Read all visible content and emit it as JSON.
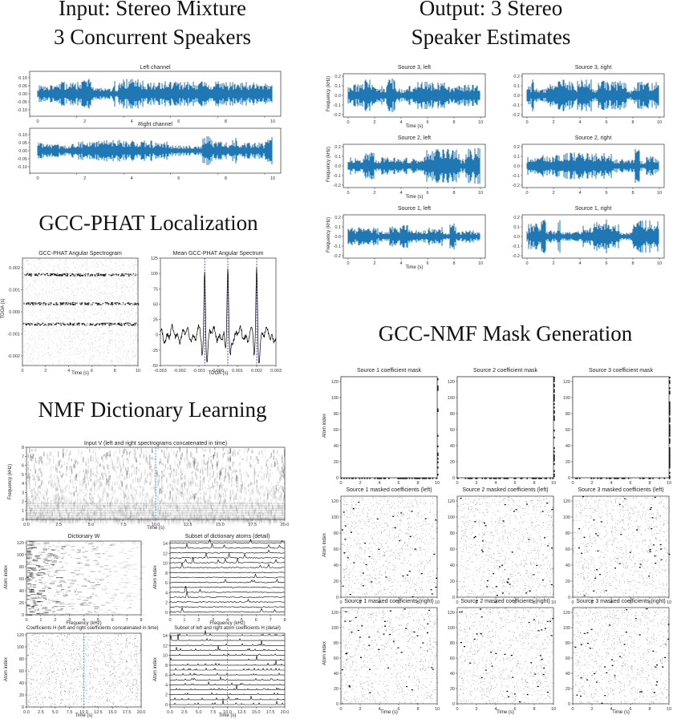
{
  "headings": {
    "input": [
      "Input: Stereo Mixture",
      "3 Concurrent Speakers"
    ],
    "output": [
      "Output: 3 Stereo",
      "Speaker Estimates"
    ],
    "gcc_phat": "GCC-PHAT Localization",
    "nmf": "NMF Dictionary Learning",
    "mask": "GCC-NMF Mask Generation"
  },
  "input_panels": {
    "left_title": "Left channel",
    "right_title": "Right channel",
    "yticks": [
      "0.10",
      "0.05",
      "0.00",
      "-0.05",
      "-0.10"
    ],
    "xticks": [
      "0",
      "2",
      "4",
      "6",
      "8",
      "10"
    ]
  },
  "output_panels": {
    "titles": [
      "Source 3, left",
      "Source 3, right",
      "Source 2, left",
      "Source 2, right",
      "Source 1, left",
      "Source 1, right"
    ],
    "ylabel": "Frequency (kHz)",
    "xlabel": "Time (s)",
    "yticks": [
      "0.2",
      "0.1",
      "0.0",
      "-0.1",
      "-0.2"
    ],
    "xticks": [
      "0",
      "2",
      "4",
      "6",
      "8",
      "10"
    ]
  },
  "gcc_panels": {
    "spectrogram_title": "GCC-PHAT Angular Spectrogram",
    "spectrogram_ylabel": "TDOA (s)",
    "spectrogram_xlabel": "Time (s)",
    "spectrogram_yticks": [
      "0.002",
      "0.001",
      "0.000",
      "-0.001",
      "-0.002"
    ],
    "spectrogram_xticks": [
      "0",
      "2",
      "4",
      "6",
      "8",
      "10"
    ],
    "mean_title": "Mean GCC-PHAT Angular Spectrum",
    "mean_xlabel": "TDOA (s)",
    "mean_yticks": [
      "125",
      "100",
      "75",
      "50",
      "25",
      "0",
      "-25",
      "-50"
    ],
    "mean_xticks": [
      "-0.003",
      "-0.002",
      "-0.001",
      "0.000",
      "0.001",
      "0.002",
      "0.003"
    ],
    "peak_tdoas": [
      -0.0007,
      0.0005,
      0.002
    ]
  },
  "nmf_panels": {
    "v_title": "Input V (left and right spectrograms concatenated in time)",
    "v_ylabel": "Frequency (kHz)",
    "v_xlabel": "Time (s)",
    "v_yticks": [
      "8",
      "7",
      "6",
      "5",
      "4",
      "3",
      "2",
      "1",
      "0"
    ],
    "v_xticks": [
      "0.0",
      "2.5",
      "5.0",
      "7.5",
      "10.0",
      "12.5",
      "15.0",
      "17.5",
      "20.0"
    ],
    "w_title": "Dictionary W",
    "w_ylabel": "Atom index",
    "w_xlabel": "Frequency (kHz)",
    "w_yticks": [
      "120",
      "100",
      "80",
      "60",
      "40",
      "20",
      "0"
    ],
    "w_xticks": [
      "0",
      "1",
      "2",
      "3",
      "4",
      "5",
      "6",
      "7",
      "8"
    ],
    "wd_title": "Subset of dictionary atoms (detail)",
    "wd_ylabel": "Atom index",
    "wd_xlabel": "Frequency (kHz)",
    "wd_yticks": [
      "14",
      "12",
      "10",
      "8",
      "6",
      "4",
      "2",
      "0"
    ],
    "wd_xticks": [
      "0",
      "1",
      "2",
      "3",
      "4",
      "5",
      "6",
      "7",
      "8"
    ],
    "h_title": "Coefficients H (left and right coefficients concatenated in time)",
    "h_ylabel": "Atom index",
    "h_xlabel": "Time (s)",
    "h_yticks": [
      "120",
      "100",
      "80",
      "60",
      "40",
      "20",
      "0"
    ],
    "h_xticks": [
      "0.0",
      "2.5",
      "5.0",
      "7.5",
      "10.0",
      "12.5",
      "15.0",
      "17.5",
      "20.0"
    ],
    "hd_title": "Subset of left and right atom coefficients H (detail)",
    "hd_ylabel": "Atom index",
    "hd_xlabel": "Time (s)",
    "hd_yticks": [
      "14",
      "12",
      "10",
      "8",
      "6",
      "4",
      "2",
      "0"
    ],
    "hd_xticks": [
      "0.0",
      "2.5",
      "5.0",
      "7.5",
      "10.0",
      "12.5",
      "15.0",
      "17.5",
      "20.0"
    ]
  },
  "mask_panels": {
    "titles": [
      "Source 1 coefficient mask",
      "Source 2 coefficient mask",
      "Source 3 coefficient mask",
      "Source 1 masked coefficients (left)",
      "Source 2 masked coefficients (left)",
      "Source 3 masked coefficients (left)",
      "Source 1 masked coefficients (right)",
      "Source 2 masked coefficients (right)",
      "Source 3 masked coefficients (right)"
    ],
    "ylabel": "Atom index",
    "xlabel": "Time (s)",
    "yticks": [
      "120",
      "100",
      "80",
      "60",
      "40",
      "20",
      "0"
    ],
    "xticks": [
      "0",
      "2",
      "4",
      "6",
      "8",
      "10"
    ]
  },
  "colors": {
    "waveform": "#1f77b4",
    "tdoa_marker": "#1f1fdf",
    "divider": "#4a8fd0",
    "ink": "#000000"
  }
}
